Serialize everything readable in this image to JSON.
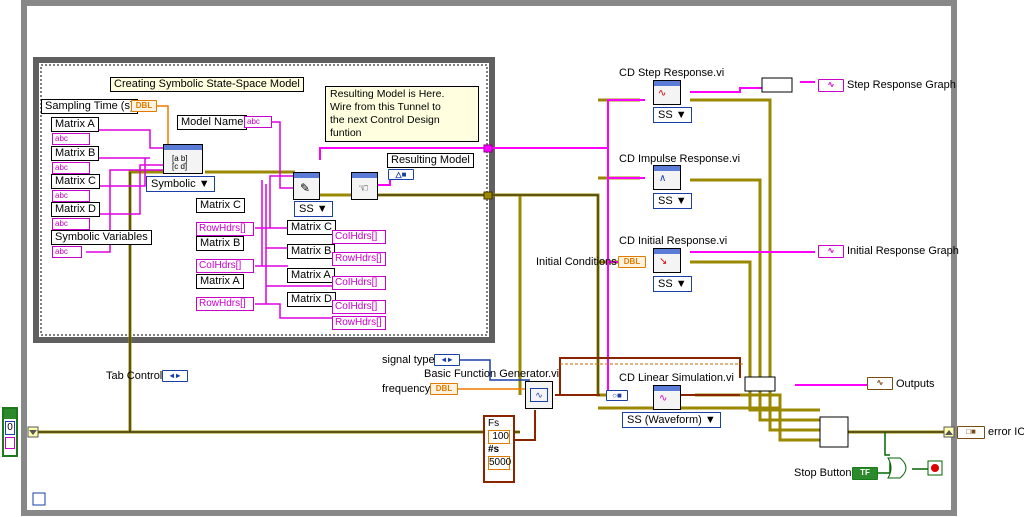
{
  "structure": {
    "frame_label": "Creating Symbolic State-Space Model",
    "note": [
      "Resulting Model is Here.",
      "Wire from this Tunnel to",
      "the next Control Design funtion"
    ]
  },
  "inputs": {
    "sampling_time": "Sampling Time (s)",
    "matrix_a": "Matrix A",
    "matrix_b": "Matrix B",
    "matrix_c": "Matrix C",
    "matrix_d": "Matrix D",
    "symbolic_variables": "Symbolic Variables",
    "model_name": "Model Name",
    "resulting_model": "Resulting Model",
    "symbolic_selector": "Symbolic",
    "ss_selector": "SS",
    "tab_control": "Tab Control",
    "signal_type": "signal type",
    "frequency": "frequency",
    "initial_conditions": "Initial Conditions",
    "stop_button": "Stop Button",
    "loop_counter": "0"
  },
  "property_nodes": [
    {
      "name": "Matrix C",
      "p1": "RowHdrs[]",
      "p2": "CoIHdrs[]"
    },
    {
      "name": "Matrix B",
      "p1": "CoIHdrs[]",
      "p2": "RowHdrs[]"
    },
    {
      "name": "Matrix A",
      "p1": "RowHdrs[]",
      "p2": "CoIHdrs[]"
    },
    {
      "name": "Matrix D",
      "p1": "CoIHdrs[]",
      "p2": "RowHdrs[]"
    }
  ],
  "left_nodes": [
    {
      "name": "Matrix C",
      "p1": "RowHdrs[]"
    },
    {
      "name": "Matrix B",
      "p1": "CoIHdrs[]"
    },
    {
      "name": "Matrix A",
      "p1": "RowHdrs[]"
    }
  ],
  "vis": {
    "step": "CD Step Response.vi",
    "impulse": "CD Impulse Response.vi",
    "initial": "CD Initial Response.vi",
    "linsim": "CD Linear Simulation.vi",
    "bfg": "Basic Function Generator.vi",
    "ss_label": "SS",
    "ss_waveform": "SS (Waveform)"
  },
  "outputs": {
    "step_graph": "Step Response Graph",
    "initial_graph": "Initial Response Graph",
    "outputs": "Outputs",
    "error_io": "error IO"
  },
  "cluster": {
    "fs_label": "Fs",
    "fs_value": "100",
    "ns_label": "#s",
    "ns_value": "5000"
  },
  "terminals": {
    "dbl": "DBL",
    "abc": "abc",
    "tf": "TF",
    "ring": "◂ ▸"
  },
  "wire_colors": {
    "string": "#e000e0",
    "dbl": "#f07800",
    "error": "#aa8800",
    "model": "#ff00ff",
    "bool": "#006600",
    "waveform": "#8b2500"
  }
}
